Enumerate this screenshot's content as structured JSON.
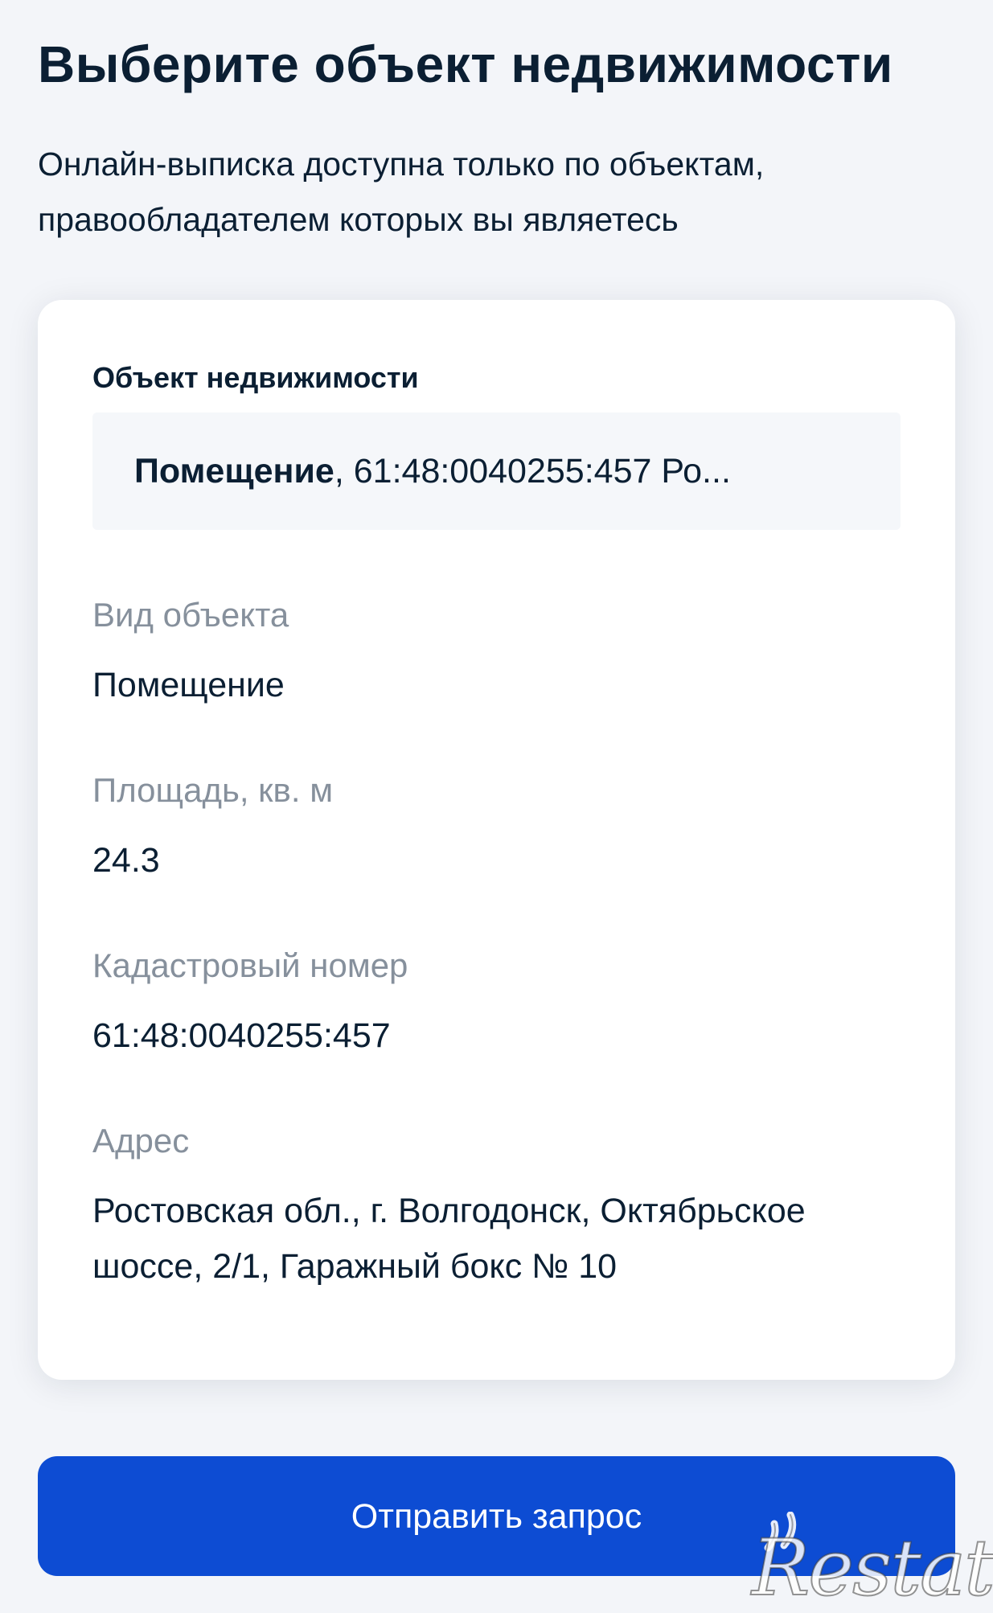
{
  "page": {
    "title": "Выберите объект недвижимости",
    "subtitle_line1": "Онлайн-выписка доступна только по объектам,",
    "subtitle_line2": "правообладателем которых вы являетесь"
  },
  "object_select": {
    "label": "Объект недвижимости",
    "selected_type": "Помещение",
    "selected_rest": ", 61:48:0040255:457 Ро..."
  },
  "details": {
    "type_label": "Вид объекта",
    "type_value": "Помещение",
    "area_label": "Площадь, кв. м",
    "area_value": "24.3",
    "cadastral_label": "Кадастровый номер",
    "cadastral_value": "61:48:0040255:457",
    "address_label": "Адрес",
    "address_line1": "Ростовская обл., г. Волгодонск, Октябрьское",
    "address_line2": "шоссе, 2/1, Гаражный бокс № 10"
  },
  "actions": {
    "submit_label": "Отправить запрос"
  },
  "watermark": {
    "text": "Restate"
  },
  "colors": {
    "primary_button": "#0d4cd3",
    "text": "#0b1f33",
    "muted_label": "#86909c",
    "page_background": "#f3f5f9",
    "select_background": "#f5f7fa"
  }
}
